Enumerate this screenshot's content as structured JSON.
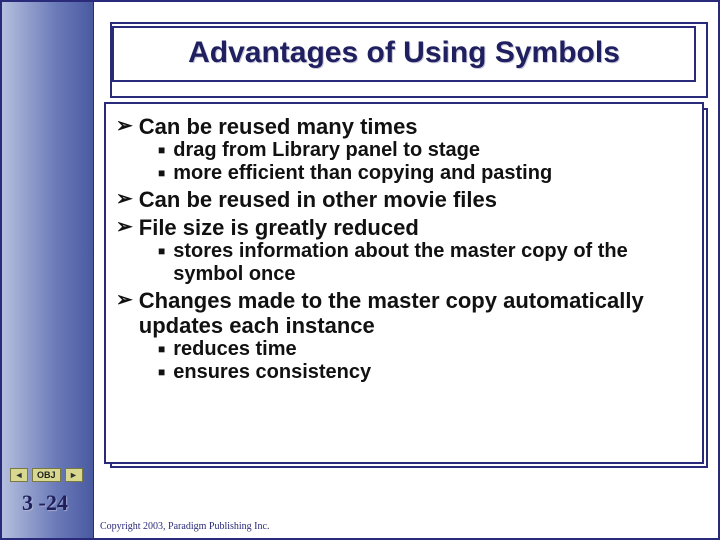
{
  "title": "Advantages of Using Symbols",
  "bullets": {
    "b1": "Can be reused many times",
    "b1a": "drag from Library panel to stage",
    "b1b": "more efficient than copying and pasting",
    "b2": "Can be reused in other movie files",
    "b3": "File size is greatly reduced",
    "b3a": "stores information about the master copy of the symbol once",
    "b4": "Changes made to the master copy automatically updates each instance",
    "b4a": "reduces time",
    "b4b": "ensures consistency"
  },
  "nav": {
    "prev": "◄",
    "label": "OBJ",
    "next": "►"
  },
  "slide_number": "3 -24",
  "copyright": "Copyright 2003, Paradigm Publishing Inc."
}
